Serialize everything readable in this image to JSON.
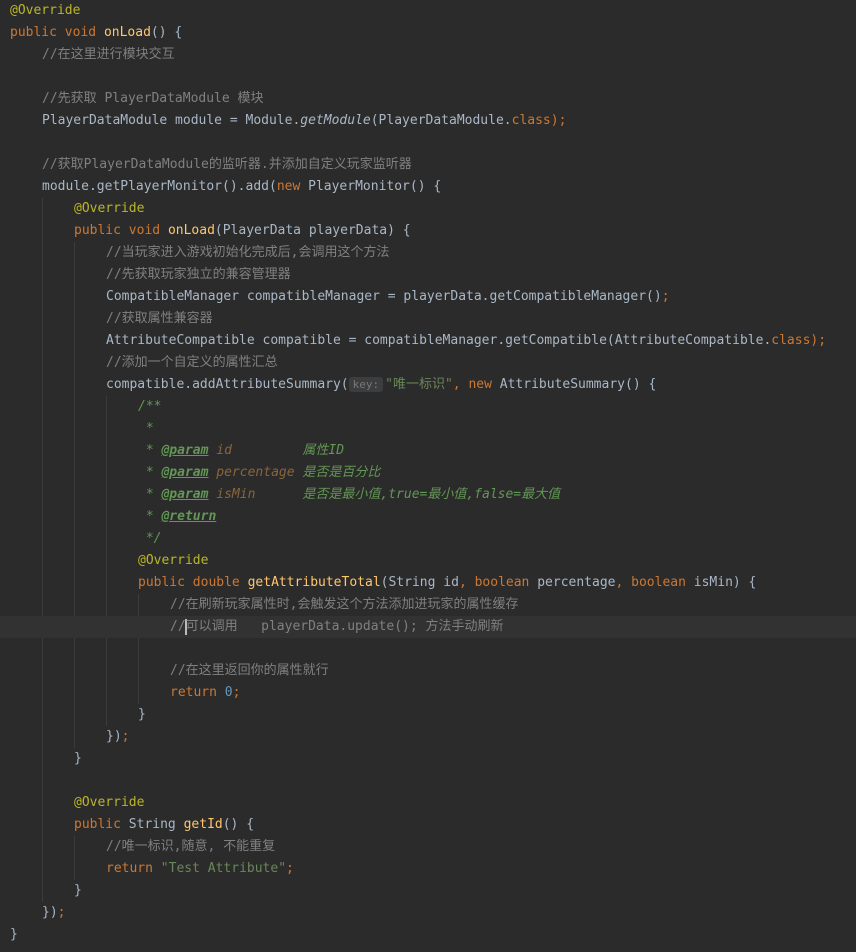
{
  "colors": {
    "background": "#2b2b2b",
    "text": "#a9b7c6",
    "keyword": "#cc7832",
    "annotation": "#bbb529",
    "method": "#ffc66d",
    "comment": "#808080",
    "javadoc": "#629755",
    "string": "#6a8759",
    "number": "#6897bb",
    "current_line": "#323232"
  },
  "editor": {
    "language": "java",
    "caret": {
      "line": 28,
      "after": "//"
    },
    "lines": [
      {
        "indent": 0,
        "tokens": [
          [
            "ann",
            "@Override"
          ]
        ]
      },
      {
        "indent": 0,
        "tokens": [
          [
            "kw",
            "public"
          ],
          [
            "pl",
            " "
          ],
          [
            "kw",
            "void"
          ],
          [
            "pl",
            " "
          ],
          [
            "mth",
            "onLoad"
          ],
          [
            "pl",
            "() {"
          ]
        ]
      },
      {
        "indent": 1,
        "tokens": [
          [
            "cmt",
            "//在这里进行模块交互"
          ]
        ]
      },
      {
        "indent": 0,
        "tokens": []
      },
      {
        "indent": 1,
        "tokens": [
          [
            "cmt",
            "//先获取 PlayerDataModule 模块"
          ]
        ]
      },
      {
        "indent": 1,
        "tokens": [
          [
            "pl",
            "PlayerDataModule module = Module."
          ],
          [
            "sm",
            "getModule"
          ],
          [
            "pl",
            "(PlayerDataModule."
          ],
          [
            "kw",
            "class"
          ],
          [
            "kw",
            ");"
          ]
        ]
      },
      {
        "indent": 0,
        "tokens": []
      },
      {
        "indent": 1,
        "tokens": [
          [
            "cmt",
            "//获取PlayerDataModule的监听器.并添加自定义玩家监听器"
          ]
        ]
      },
      {
        "indent": 1,
        "tokens": [
          [
            "pl",
            "module.getPlayerMonitor().add("
          ],
          [
            "kw",
            "new"
          ],
          [
            "pl",
            " PlayerMonitor() {"
          ]
        ]
      },
      {
        "indent": 2,
        "tokens": [
          [
            "ann",
            "@Override"
          ]
        ]
      },
      {
        "indent": 2,
        "tokens": [
          [
            "kw",
            "public"
          ],
          [
            "pl",
            " "
          ],
          [
            "kw",
            "void"
          ],
          [
            "pl",
            " "
          ],
          [
            "mth",
            "onLoad"
          ],
          [
            "pl",
            "(PlayerData playerData) {"
          ]
        ]
      },
      {
        "indent": 3,
        "tokens": [
          [
            "cmt",
            "//当玩家进入游戏初始化完成后,会调用这个方法"
          ]
        ]
      },
      {
        "indent": 3,
        "tokens": [
          [
            "cmt",
            "//先获取玩家独立的兼容管理器"
          ]
        ]
      },
      {
        "indent": 3,
        "tokens": [
          [
            "pl",
            "CompatibleManager compatibleManager = playerData.getCompatibleManager()"
          ],
          [
            "kw",
            ";"
          ]
        ]
      },
      {
        "indent": 3,
        "tokens": [
          [
            "cmt",
            "//获取属性兼容器"
          ]
        ]
      },
      {
        "indent": 3,
        "tokens": [
          [
            "pl",
            "AttributeCompatible compatible = compatibleManager.getCompatible(AttributeCompatible."
          ],
          [
            "kw",
            "class"
          ],
          [
            "kw",
            ");"
          ]
        ]
      },
      {
        "indent": 3,
        "tokens": [
          [
            "cmt",
            "//添加一个自定义的属性汇总"
          ]
        ]
      },
      {
        "indent": 3,
        "tokens": [
          [
            "pl",
            "compatible.addAttributeSummary("
          ],
          [
            "hint",
            "key:"
          ],
          [
            "str",
            "\"唯一标识\""
          ],
          [
            "kw",
            ","
          ],
          [
            "pl",
            " "
          ],
          [
            "kw",
            "new"
          ],
          [
            "pl",
            " AttributeSummary() {"
          ]
        ]
      },
      {
        "indent": 4,
        "tokens": [
          [
            "doc",
            "/**"
          ]
        ]
      },
      {
        "indent": 4,
        "tokens": [
          [
            "doc",
            " *"
          ]
        ]
      },
      {
        "indent": 4,
        "tokens": [
          [
            "doc",
            " * "
          ],
          [
            "doctag",
            "@param"
          ],
          [
            "doc",
            " "
          ],
          [
            "docparam",
            "id"
          ],
          [
            "doc",
            "         属性ID"
          ]
        ]
      },
      {
        "indent": 4,
        "tokens": [
          [
            "doc",
            " * "
          ],
          [
            "doctag",
            "@param"
          ],
          [
            "doc",
            " "
          ],
          [
            "docparam",
            "percentage"
          ],
          [
            "doc",
            " 是否是百分比"
          ]
        ]
      },
      {
        "indent": 4,
        "tokens": [
          [
            "doc",
            " * "
          ],
          [
            "doctag",
            "@param"
          ],
          [
            "doc",
            " "
          ],
          [
            "docparam",
            "isMin"
          ],
          [
            "doc",
            "      是否是最小值,true=最小值,false=最大值"
          ]
        ]
      },
      {
        "indent": 4,
        "tokens": [
          [
            "doc",
            " * "
          ],
          [
            "doctag",
            "@return"
          ]
        ]
      },
      {
        "indent": 4,
        "tokens": [
          [
            "doc",
            " */"
          ]
        ]
      },
      {
        "indent": 4,
        "tokens": [
          [
            "ann",
            "@Override"
          ]
        ]
      },
      {
        "indent": 4,
        "tokens": [
          [
            "kw",
            "public"
          ],
          [
            "pl",
            " "
          ],
          [
            "kw",
            "double"
          ],
          [
            "pl",
            " "
          ],
          [
            "mth",
            "getAttributeTotal"
          ],
          [
            "pl",
            "(String id"
          ],
          [
            "kw",
            ","
          ],
          [
            "pl",
            " "
          ],
          [
            "kw",
            "boolean"
          ],
          [
            "pl",
            " percentage"
          ],
          [
            "kw",
            ","
          ],
          [
            "pl",
            " "
          ],
          [
            "kw",
            "boolean"
          ],
          [
            "pl",
            " isMin) {"
          ]
        ]
      },
      {
        "indent": 5,
        "tokens": [
          [
            "cmt",
            "//在刷新玩家属性时,会触发这个方法添加进玩家的属性缓存"
          ]
        ]
      },
      {
        "indent": 5,
        "tokens": [
          [
            "cmt",
            "//"
          ],
          [
            "caret",
            ""
          ],
          [
            "cmt",
            "可以调用   playerData.update(); 方法手动刷新"
          ]
        ]
      },
      {
        "indent": 0,
        "tokens": []
      },
      {
        "indent": 5,
        "tokens": [
          [
            "cmt",
            "//在这里返回你的属性就行"
          ]
        ]
      },
      {
        "indent": 5,
        "tokens": [
          [
            "kw",
            "return"
          ],
          [
            "pl",
            " "
          ],
          [
            "num",
            "0"
          ],
          [
            "kw",
            ";"
          ]
        ]
      },
      {
        "indent": 4,
        "tokens": [
          [
            "pl",
            "}"
          ]
        ]
      },
      {
        "indent": 3,
        "tokens": [
          [
            "pl",
            "})"
          ],
          [
            "kw",
            ";"
          ]
        ]
      },
      {
        "indent": 2,
        "tokens": [
          [
            "pl",
            "}"
          ]
        ]
      },
      {
        "indent": 0,
        "tokens": []
      },
      {
        "indent": 2,
        "tokens": [
          [
            "ann",
            "@Override"
          ]
        ]
      },
      {
        "indent": 2,
        "tokens": [
          [
            "kw",
            "public"
          ],
          [
            "pl",
            " String "
          ],
          [
            "mth",
            "getId"
          ],
          [
            "pl",
            "() {"
          ]
        ]
      },
      {
        "indent": 3,
        "tokens": [
          [
            "cmt",
            "//唯一标识,随意, 不能重复"
          ]
        ]
      },
      {
        "indent": 3,
        "tokens": [
          [
            "kw",
            "return"
          ],
          [
            "pl",
            " "
          ],
          [
            "str",
            "\"Test Attribute\""
          ],
          [
            "kw",
            ";"
          ]
        ]
      },
      {
        "indent": 2,
        "tokens": [
          [
            "pl",
            "}"
          ]
        ]
      },
      {
        "indent": 1,
        "tokens": [
          [
            "pl",
            "})"
          ],
          [
            "kw",
            ";"
          ]
        ]
      },
      {
        "indent": 0,
        "tokens": [
          [
            "pl",
            "}"
          ]
        ]
      }
    ]
  }
}
